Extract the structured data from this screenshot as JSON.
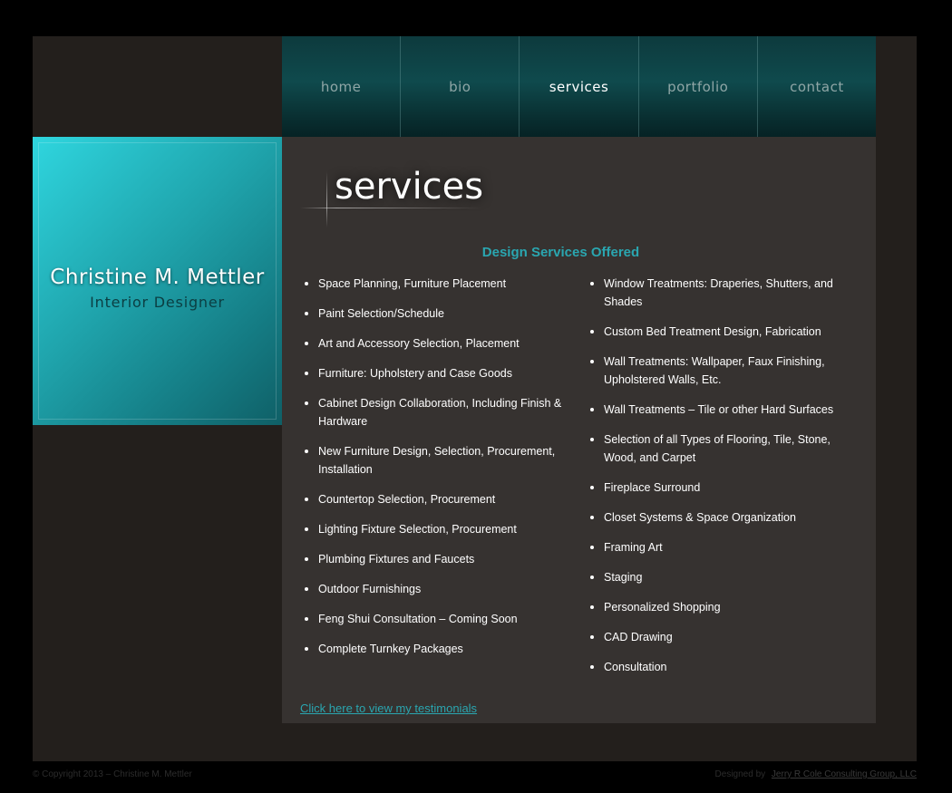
{
  "nav": {
    "items": [
      {
        "label": "home"
      },
      {
        "label": "bio"
      },
      {
        "label": "services"
      },
      {
        "label": "portfolio"
      },
      {
        "label": "contact"
      }
    ],
    "active": "services"
  },
  "logo": {
    "name": "Christine M. Mettler",
    "title": "Interior Designer"
  },
  "main": {
    "heading": "services",
    "subheading": "Design Services Offered",
    "services_left": [
      "Space Planning, Furniture Placement",
      "Paint Selection/Schedule",
      "Art and Accessory Selection, Placement",
      "Furniture: Upholstery and Case Goods",
      "Cabinet Design Collaboration, Including Finish & Hardware",
      "New Furniture Design, Selection, Procurement, Installation",
      "Countertop Selection, Procurement",
      "Lighting Fixture Selection, Procurement",
      "Plumbing Fixtures and Faucets",
      "Outdoor Furnishings",
      "Feng Shui Consultation – Coming Soon",
      "Complete Turnkey Packages"
    ],
    "services_right": [
      "Window Treatments: Draperies, Shutters, and Shades",
      "Custom Bed Treatment Design, Fabrication",
      "Wall Treatments: Wallpaper, Faux Finishing, Upholstered Walls, Etc.",
      "Wall Treatments – Tile or other Hard Surfaces",
      "Selection of all Types of Flooring, Tile, Stone, Wood, and Carpet",
      "Fireplace Surround",
      "Closet Systems & Space Organization",
      "Framing Art",
      "Staging",
      "Personalized Shopping",
      "CAD Drawing",
      "Consultation"
    ],
    "testimonials_link": "Click here to view my testimonials"
  },
  "footer": {
    "copyright": "© Copyright 2013 – Christine M. Mettler",
    "designed_by_label": "Designed by",
    "designer_link": "Jerry R Cole Consulting Group, LLC"
  },
  "colors": {
    "accent": "#2aa6b0",
    "nav_bg": "#0f4a4d",
    "logo_bg": "#1fa3ab",
    "content_bg": "#363230",
    "frame_bg": "#231f1c"
  }
}
